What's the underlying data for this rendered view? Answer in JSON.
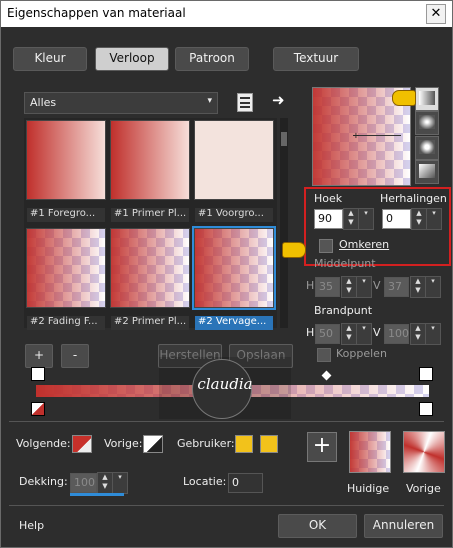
{
  "window": {
    "title": "Eigenschappen van materiaal",
    "close_icon": "close-icon"
  },
  "tabs": [
    {
      "label": "Kleur",
      "active": false
    },
    {
      "label": "Verloop",
      "active": true
    },
    {
      "label": "Patroon",
      "active": false
    },
    {
      "label": "Textuur",
      "active": false
    }
  ],
  "category": {
    "value": "Alles"
  },
  "gradients": [
    {
      "label": "#1 Foregro..."
    },
    {
      "label": "#1 Primer Pl..."
    },
    {
      "label": "#1 Voorgro..."
    },
    {
      "label": "#2 Fading F..."
    },
    {
      "label": "#2 Primer Pl..."
    },
    {
      "label": "#2 Vervage...",
      "selected": true
    }
  ],
  "properties": {
    "angle_label": "Hoek",
    "angle_value": "90",
    "repeats_label": "Herhalingen",
    "repeats_value": "0",
    "invert_label": "Omkeren",
    "invert_checked": false,
    "midpoint_label": "Middelpunt",
    "midpoint_h_label": "H",
    "midpoint_h": "35",
    "midpoint_v_label": "V",
    "midpoint_v": "37",
    "focal_label": "Brandpunt",
    "focal_h_label": "H",
    "focal_h": "50",
    "focal_v_label": "V",
    "focal_v": "100",
    "link_label": "Koppelen"
  },
  "editor": {
    "add_label": "+",
    "remove_label": "-",
    "restore_label": "Herstellen",
    "save_label": "Opslaan",
    "watermark_text": "claudia"
  },
  "bottom": {
    "next_label": "Volgende:",
    "prev_label": "Vorige:",
    "user_label": "Gebruiker:",
    "opacity_label": "Dekking:",
    "opacity_value": "100",
    "location_label": "Locatie:",
    "location_value": "0",
    "current_label": "Huidige",
    "previous_label": "Vorige",
    "add_swatch_label": "+",
    "user_color": "#f2c21b",
    "accent_red": "#c7302a"
  },
  "footer": {
    "help_label": "Help",
    "ok_label": "OK",
    "cancel_label": "Annuleren"
  }
}
